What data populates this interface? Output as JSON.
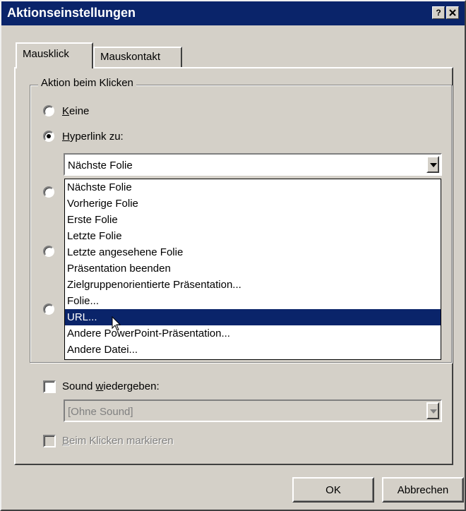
{
  "dialog": {
    "title": "Aktionseinstellungen",
    "help_button": "?",
    "close_button": "X"
  },
  "tabs": [
    {
      "label": "Mausklick",
      "active": true
    },
    {
      "label": "Mauskontakt",
      "active": false
    }
  ],
  "action_group": {
    "legend": "Aktion beim Klicken",
    "options": [
      {
        "key_letter": "K",
        "rest": "eine",
        "checked": false
      },
      {
        "key_letter": "H",
        "rest": "yperlink zu:",
        "checked": true
      }
    ],
    "hyperlink_combo": {
      "value": "Nächste Folie",
      "open": true,
      "items": [
        "Nächste Folie",
        "Vorherige Folie",
        "Erste Folie",
        "Letzte Folie",
        "Letzte angesehene Folie",
        "Präsentation beenden",
        "Zielgruppenorientierte Präsentation...",
        "Folie...",
        "URL...",
        "Andere PowerPoint-Präsentation...",
        "Andere Datei..."
      ],
      "selected_index": 8
    }
  },
  "sound": {
    "label_before": "Sound ",
    "label_key": "w",
    "label_after": "iedergeben:",
    "checked": false,
    "combo_value": "[Ohne Sound]"
  },
  "highlight": {
    "label_key": "B",
    "label_after": "eim Klicken markieren",
    "checked": false,
    "disabled": true
  },
  "buttons": {
    "ok": "OK",
    "cancel": "Abbrechen"
  },
  "colors": {
    "titlebar": "#0a246a",
    "face": "#d4d0c8",
    "selection": "#0a246a"
  }
}
